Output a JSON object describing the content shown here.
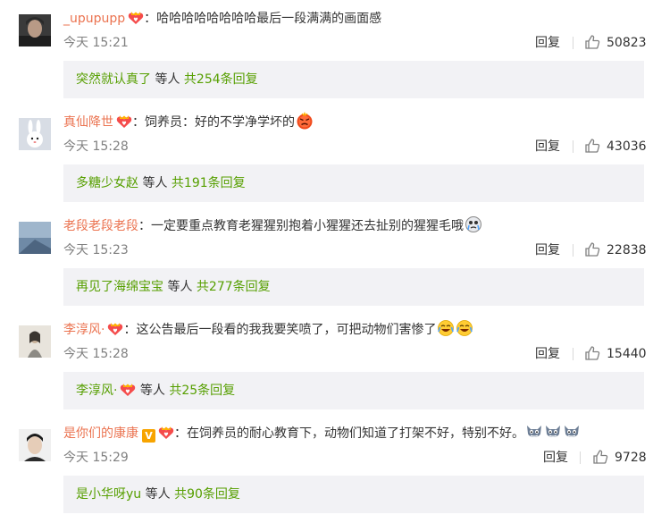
{
  "comments": [
    {
      "username": "_upupupp",
      "badge": "vip-fan-badge",
      "colon": "：",
      "text": "哈哈哈哈哈哈哈哈最后一段满满的画面感",
      "time": "今天 15:21",
      "reply_label": "回复",
      "likes": "50823",
      "sub_user": "突然就认真了",
      "sub_mid": " 等人 ",
      "sub_count": "共254条回复"
    },
    {
      "username": "真仙降世",
      "badge": "vip-fan-badge",
      "colon": "：",
      "text": "饲养员：好的不学净学坏的",
      "emoji": "angry-face-icon",
      "time": "今天 15:28",
      "reply_label": "回复",
      "likes": "43036",
      "sub_user": "多糖少女赵",
      "sub_mid": " 等人 ",
      "sub_count": "共191条回复"
    },
    {
      "username": "老段老段老段",
      "colon": "：",
      "text": "一定要重点教育老猩猩别抱着小猩猩还去扯别的猩猩毛哦",
      "emoji": "crying-face-icon",
      "time": "今天 15:23",
      "reply_label": "回复",
      "likes": "22838",
      "sub_user": "再见了海绵宝宝",
      "sub_mid": " 等人 ",
      "sub_count": "共277条回复"
    },
    {
      "username": "李淳风·",
      "badge": "vip-fan-badge",
      "colon": "：",
      "text": "这公告最后一段看的我我要笑喷了，可把动物们害惨了",
      "emoji": "laughing-tears-icon",
      "time": "今天 15:28",
      "reply_label": "回复",
      "likes": "15440",
      "sub_user": "李淳风·",
      "sub_mid": " 等人 ",
      "sub_count": "共25条回复"
    },
    {
      "username": "是你们的康康",
      "vip": "V",
      "badge": "vip-fan-badge",
      "colon": "：",
      "text": "在饲养员的耐心教育下，动物们知道了打架不好，特别不好。",
      "emoji": "tom-cat-icon",
      "time": "今天 15:29",
      "reply_label": "回复",
      "likes": "9728",
      "sub_user": "是小华呀yu",
      "sub_mid": " 等人 ",
      "sub_count": "共90条回复"
    }
  ],
  "colors": {
    "username": "#eb7350",
    "link_green": "#569f00",
    "reply_bg": "#f2f2f5",
    "time_gray": "#808080"
  }
}
